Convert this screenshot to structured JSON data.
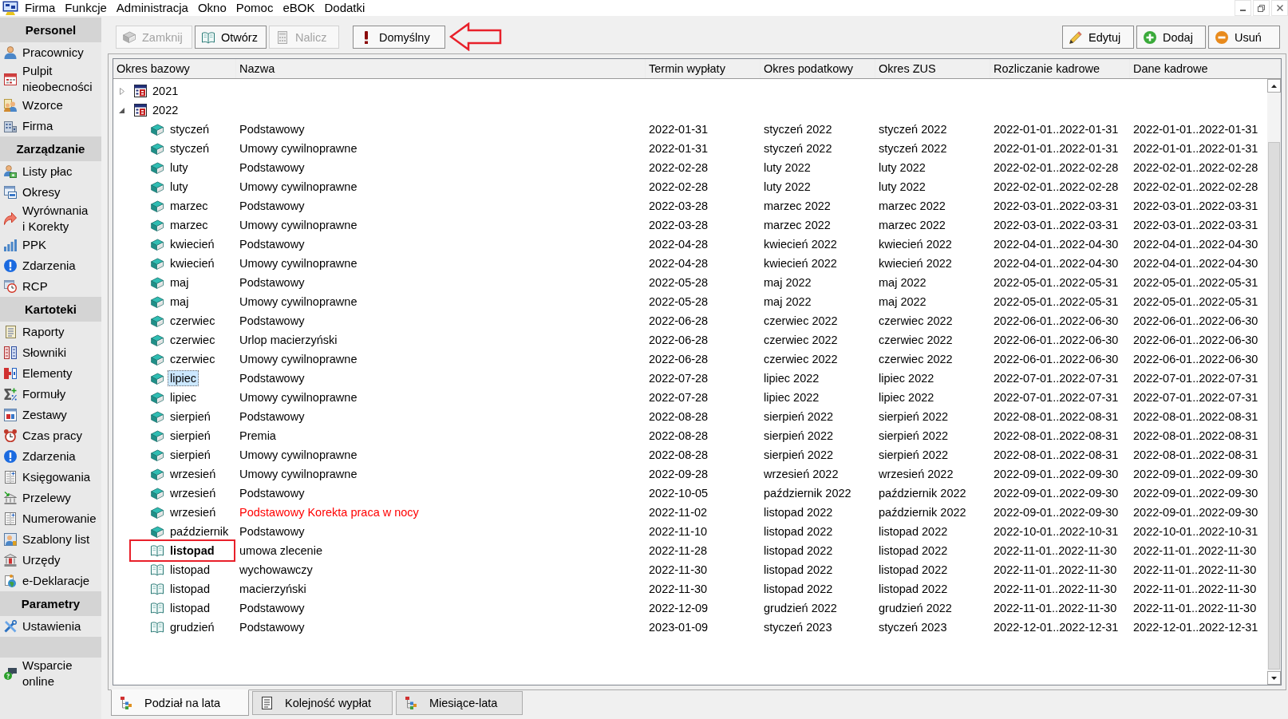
{
  "menu": [
    "Firma",
    "Funkcje",
    "Administracja",
    "Okno",
    "Pomoc",
    "eBOK",
    "Dodatki"
  ],
  "sidebar": [
    {
      "title": "Personel",
      "items": [
        "Pracownicy",
        "Pulpit nieobecności",
        "Wzorce",
        "Firma"
      ]
    },
    {
      "title": "Zarządzanie",
      "items": [
        "Listy płac",
        "Okresy",
        "Wyrównania i Korekty",
        "PPK",
        "Zdarzenia",
        "RCP"
      ]
    },
    {
      "title": "Kartoteki",
      "items": [
        "Raporty",
        "Słowniki",
        "Elementy",
        "Formuły",
        "Zestawy",
        "Czas pracy",
        "Zdarzenia",
        "Księgowania",
        "Przelewy",
        "Numerowanie",
        "Szablony list",
        "Urzędy",
        "e-Deklaracje"
      ]
    },
    {
      "title": "Parametry",
      "items": [
        "Ustawienia"
      ]
    },
    {
      "items": [
        "Wsparcie online"
      ]
    }
  ],
  "toolbar_groups": [
    [
      {
        "label": "Zamknij",
        "disabled": true,
        "callout_arrow": false
      },
      {
        "label": "Otwórz",
        "disabled": false,
        "callout_arrow": false
      },
      {
        "label": "Nalicz",
        "disabled": true,
        "callout_arrow": false
      }
    ],
    [
      {
        "label": "Domyślny",
        "disabled": false,
        "callout_arrow": true
      }
    ],
    [
      {
        "label": "Edytuj",
        "disabled": false,
        "callout_arrow": false
      },
      {
        "label": "Dodaj",
        "disabled": false,
        "callout_arrow": false
      },
      {
        "label": "Usuń",
        "disabled": false,
        "callout_arrow": false
      }
    ]
  ],
  "table": {
    "columns": [
      "Okres bazowy",
      "Nazwa",
      "Termin wypłaty",
      "Okres podatkowy",
      "Okres ZUS",
      "Rozliczanie kadrowe",
      "Dane kadrowe"
    ],
    "tree": [
      {
        "label": "2021",
        "expanded": false
      },
      {
        "label": "2022",
        "expanded": true,
        "children": [
          {
            "cells": [
              "styczeń",
              "Podstawowy",
              "2022-01-31",
              "styczeń 2022",
              "styczeń 2022",
              "2022-01-01..2022-01-31",
              "2022-01-01..2022-01-31"
            ],
            "closed": true,
            "selected": false,
            "bold": false,
            "callout_frame": false
          },
          {
            "cells": [
              "styczeń",
              "Umowy cywilnoprawne",
              "2022-01-31",
              "styczeń 2022",
              "styczeń 2022",
              "2022-01-01..2022-01-31",
              "2022-01-01..2022-01-31"
            ],
            "closed": true,
            "selected": false,
            "bold": false,
            "callout_frame": false
          },
          {
            "cells": [
              "luty",
              "Podstawowy",
              "2022-02-28",
              "luty 2022",
              "luty 2022",
              "2022-02-01..2022-02-28",
              "2022-02-01..2022-02-28"
            ],
            "closed": true,
            "selected": false,
            "bold": false,
            "callout_frame": false
          },
          {
            "cells": [
              "luty",
              "Umowy cywilnoprawne",
              "2022-02-28",
              "luty 2022",
              "luty 2022",
              "2022-02-01..2022-02-28",
              "2022-02-01..2022-02-28"
            ],
            "closed": true,
            "selected": false,
            "bold": false,
            "callout_frame": false
          },
          {
            "cells": [
              "marzec",
              "Podstawowy",
              "2022-03-28",
              "marzec 2022",
              "marzec 2022",
              "2022-03-01..2022-03-31",
              "2022-03-01..2022-03-31"
            ],
            "closed": true,
            "selected": false,
            "bold": false,
            "callout_frame": false
          },
          {
            "cells": [
              "marzec",
              "Umowy cywilnoprawne",
              "2022-03-28",
              "marzec 2022",
              "marzec 2022",
              "2022-03-01..2022-03-31",
              "2022-03-01..2022-03-31"
            ],
            "closed": true,
            "selected": false,
            "bold": false,
            "callout_frame": false
          },
          {
            "cells": [
              "kwiecień",
              "Podstawowy",
              "2022-04-28",
              "kwiecień 2022",
              "kwiecień 2022",
              "2022-04-01..2022-04-30",
              "2022-04-01..2022-04-30"
            ],
            "closed": true,
            "selected": false,
            "bold": false,
            "callout_frame": false
          },
          {
            "cells": [
              "kwiecień",
              "Umowy cywilnoprawne",
              "2022-04-28",
              "kwiecień 2022",
              "kwiecień 2022",
              "2022-04-01..2022-04-30",
              "2022-04-01..2022-04-30"
            ],
            "closed": true,
            "selected": false,
            "bold": false,
            "callout_frame": false
          },
          {
            "cells": [
              "maj",
              "Podstawowy",
              "2022-05-28",
              "maj 2022",
              "maj 2022",
              "2022-05-01..2022-05-31",
              "2022-05-01..2022-05-31"
            ],
            "closed": true,
            "selected": false,
            "bold": false,
            "callout_frame": false
          },
          {
            "cells": [
              "maj",
              "Umowy cywilnoprawne",
              "2022-05-28",
              "maj 2022",
              "maj 2022",
              "2022-05-01..2022-05-31",
              "2022-05-01..2022-05-31"
            ],
            "closed": true,
            "selected": false,
            "bold": false,
            "callout_frame": false
          },
          {
            "cells": [
              "czerwiec",
              "Podstawowy",
              "2022-06-28",
              "czerwiec 2022",
              "czerwiec 2022",
              "2022-06-01..2022-06-30",
              "2022-06-01..2022-06-30"
            ],
            "closed": true,
            "selected": false,
            "bold": false,
            "callout_frame": false
          },
          {
            "cells": [
              "czerwiec",
              "Urlop macierzyński",
              "2022-06-28",
              "czerwiec 2022",
              "czerwiec 2022",
              "2022-06-01..2022-06-30",
              "2022-06-01..2022-06-30"
            ],
            "closed": true,
            "selected": false,
            "bold": false,
            "callout_frame": false
          },
          {
            "cells": [
              "czerwiec",
              "Umowy cywilnoprawne",
              "2022-06-28",
              "czerwiec 2022",
              "czerwiec 2022",
              "2022-06-01..2022-06-30",
              "2022-06-01..2022-06-30"
            ],
            "closed": true,
            "selected": false,
            "bold": false,
            "callout_frame": false
          },
          {
            "cells": [
              "lipiec",
              "Podstawowy",
              "2022-07-28",
              "lipiec 2022",
              "lipiec 2022",
              "2022-07-01..2022-07-31",
              "2022-07-01..2022-07-31"
            ],
            "closed": true,
            "selected": true,
            "bold": false,
            "callout_frame": false
          },
          {
            "cells": [
              "lipiec",
              "Umowy cywilnoprawne",
              "2022-07-28",
              "lipiec 2022",
              "lipiec 2022",
              "2022-07-01..2022-07-31",
              "2022-07-01..2022-07-31"
            ],
            "closed": true,
            "selected": false,
            "bold": false,
            "callout_frame": false
          },
          {
            "cells": [
              "sierpień",
              "Podstawowy",
              "2022-08-28",
              "sierpień 2022",
              "sierpień 2022",
              "2022-08-01..2022-08-31",
              "2022-08-01..2022-08-31"
            ],
            "closed": true,
            "selected": false,
            "bold": false,
            "callout_frame": false
          },
          {
            "cells": [
              "sierpień",
              "Premia",
              "2022-08-28",
              "sierpień 2022",
              "sierpień 2022",
              "2022-08-01..2022-08-31",
              "2022-08-01..2022-08-31"
            ],
            "closed": true,
            "selected": false,
            "bold": false,
            "callout_frame": false
          },
          {
            "cells": [
              "sierpień",
              "Umowy cywilnoprawne",
              "2022-08-28",
              "sierpień 2022",
              "sierpień 2022",
              "2022-08-01..2022-08-31",
              "2022-08-01..2022-08-31"
            ],
            "closed": true,
            "selected": false,
            "bold": false,
            "callout_frame": false
          },
          {
            "cells": [
              "wrzesień",
              "Umowy cywilnoprawne",
              "2022-09-28",
              "wrzesień 2022",
              "wrzesień 2022",
              "2022-09-01..2022-09-30",
              "2022-09-01..2022-09-30"
            ],
            "closed": true,
            "selected": false,
            "bold": false,
            "callout_frame": false
          },
          {
            "cells": [
              "wrzesień",
              "Podstawowy",
              "2022-10-05",
              "październik 2022",
              "październik 2022",
              "2022-09-01..2022-09-30",
              "2022-09-01..2022-09-30"
            ],
            "closed": true,
            "selected": false,
            "bold": false,
            "callout_frame": false
          },
          {
            "cells": [
              "wrzesień",
              "Podstawowy Korekta praca w nocy",
              "2022-11-02",
              "listopad 2022",
              "październik 2022",
              "2022-09-01..2022-09-30",
              "2022-09-01..2022-09-30"
            ],
            "closed": true,
            "selected": false,
            "bold": false,
            "callout_frame": false,
            "color": "#ff0000"
          },
          {
            "cells": [
              "październik",
              "Podstawowy",
              "2022-11-10",
              "listopad 2022",
              "listopad 2022",
              "2022-10-01..2022-10-31",
              "2022-10-01..2022-10-31"
            ],
            "closed": true,
            "selected": false,
            "bold": false,
            "callout_frame": false
          },
          {
            "cells": [
              "listopad",
              "umowa zlecenie",
              "2022-11-28",
              "listopad 2022",
              "listopad 2022",
              "2022-11-01..2022-11-30",
              "2022-11-01..2022-11-30"
            ],
            "closed": false,
            "selected": false,
            "bold": true,
            "callout_frame": true
          },
          {
            "cells": [
              "listopad",
              "wychowawczy",
              "2022-11-30",
              "listopad 2022",
              "listopad 2022",
              "2022-11-01..2022-11-30",
              "2022-11-01..2022-11-30"
            ],
            "closed": false,
            "selected": false,
            "bold": false,
            "callout_frame": false
          },
          {
            "cells": [
              "listopad",
              "macierzyński",
              "2022-11-30",
              "listopad 2022",
              "listopad 2022",
              "2022-11-01..2022-11-30",
              "2022-11-01..2022-11-30"
            ],
            "closed": false,
            "selected": false,
            "bold": false,
            "callout_frame": false
          },
          {
            "cells": [
              "listopad",
              "Podstawowy",
              "2022-12-09",
              "grudzień 2022",
              "grudzień 2022",
              "2022-11-01..2022-11-30",
              "2022-11-01..2022-11-30"
            ],
            "closed": false,
            "selected": false,
            "bold": false,
            "callout_frame": false
          },
          {
            "cells": [
              "grudzień",
              "Podstawowy",
              "2023-01-09",
              "styczeń 2023",
              "styczeń 2023",
              "2022-12-01..2022-12-31",
              "2022-12-01..2022-12-31"
            ],
            "closed": false,
            "selected": false,
            "bold": false,
            "callout_frame": false
          }
        ]
      }
    ]
  },
  "bottom_tabs": [
    {
      "label": "Podział na lata",
      "selected": true
    },
    {
      "label": "Kolejność wypłat",
      "selected": false
    },
    {
      "label": "Miesiące-lata",
      "selected": false
    }
  ]
}
